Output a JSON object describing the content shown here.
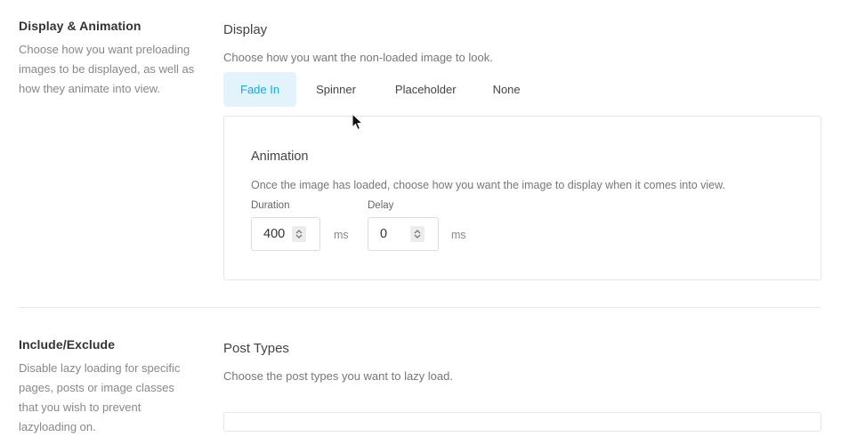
{
  "display_section": {
    "title": "Display & Animation",
    "description": "Choose how you want preloading images to be displayed, as well as how they animate into view.",
    "display": {
      "heading": "Display",
      "description": "Choose how you want the non-loaded image to look.",
      "tabs": [
        {
          "label": "Fade In",
          "active": true
        },
        {
          "label": "Spinner",
          "active": false
        },
        {
          "label": "Placeholder",
          "active": false
        },
        {
          "label": "None",
          "active": false
        }
      ]
    },
    "animation": {
      "heading": "Animation",
      "description": "Once the image has loaded, choose how you want the image to display when it comes into view.",
      "duration": {
        "label": "Duration",
        "value": "400",
        "unit": "ms"
      },
      "delay": {
        "label": "Delay",
        "value": "0",
        "unit": "ms"
      }
    }
  },
  "include_section": {
    "title": "Include/Exclude",
    "description": "Disable lazy loading for specific pages, posts or image classes that you wish to prevent lazyloading on.",
    "post_types": {
      "heading": "Post Types",
      "description": "Choose the post types you want to lazy load."
    }
  },
  "colors": {
    "accent": "#17a8e3",
    "accent_bg": "#e2f3fc",
    "border": "#e6e6e6"
  }
}
